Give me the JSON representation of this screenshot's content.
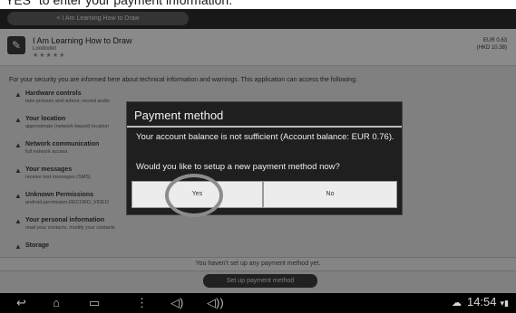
{
  "caption": "YES\" to enter your payment information.",
  "store": {
    "back_label": "< I Am Learning How to Draw",
    "app_title": "I Am Learning How to Draw",
    "developer": "Loodookit",
    "stars": "★★★★★",
    "price_eur": "EUR 0.63",
    "price_hkd": "(HKD 10.38)",
    "intro_text": "For your security you are informed here about technical information and warnings. This application can access the following:",
    "permissions": [
      {
        "title": "Hardware controls",
        "desc": "take pictures and videos, record audio"
      },
      {
        "title": "Your location",
        "desc": "approximate (network-based) location"
      },
      {
        "title": "Network communication",
        "desc": "full network access"
      },
      {
        "title": "Your messages",
        "desc": "receive text messages (SMS)"
      },
      {
        "title": "Unknown Permissions",
        "desc": "android.permission.RECORD_VIDEO"
      },
      {
        "title": "Your personal information",
        "desc": "read your contacts, modify your contacts"
      },
      {
        "title": "Storage",
        "desc": ""
      }
    ],
    "notice": "You haven't set up any payment method yet.",
    "setup_button": "Set up payment method"
  },
  "dialog": {
    "title": "Payment method",
    "message": "Your account balance is not sufficient (Account balance: EUR 0.76).",
    "question": "Would you like to setup a new payment method now?",
    "yes_label": "Yes",
    "no_label": "No"
  },
  "navbar": {
    "back_icon": "↩",
    "home_icon": "⌂",
    "recent_icon": "▭",
    "menu_icon": "⋮",
    "vol_down_icon": "◁)",
    "vol_up_icon": "◁))",
    "cloud_icon": "☁",
    "time": "14:54",
    "signal_icon": "▾▮"
  }
}
